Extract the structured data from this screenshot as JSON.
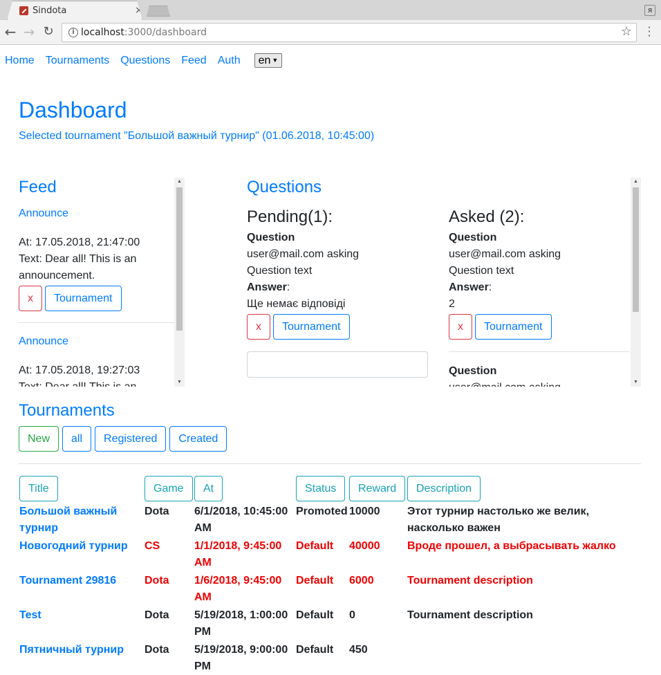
{
  "browser": {
    "tab_title": "Sindota",
    "tab_close": "×",
    "url_host": "localhost",
    "url_rest": ":3000/dashboard",
    "profile_glyph": "я"
  },
  "nav": {
    "home": "Home",
    "tournaments": "Tournaments",
    "questions": "Questions",
    "feed": "Feed",
    "auth": "Auth",
    "lang": "en"
  },
  "dashboard": {
    "title": "Dashboard",
    "selected": "Selected tournament \"Большой важный турнир\" (01.06.2018, 10:45:00)"
  },
  "feed": {
    "title": "Feed",
    "items": [
      {
        "type": "Announce",
        "at": "At: 17.05.2018, 21:47:00",
        "text": "Text: Dear all! This is an announcement.",
        "delete": "x",
        "tournament": "Tournament"
      },
      {
        "type": "Announce",
        "at": "At: 17.05.2018, 19:27:03",
        "text": "Text: Dear all! This is an"
      }
    ]
  },
  "questions": {
    "title": "Questions",
    "pending": {
      "heading": "Pending(1):",
      "question_label": "Question",
      "asker": "user@mail.com asking",
      "text": "Question text",
      "answer_label": "Answer",
      "answer": "Ще немає відповіді",
      "delete": "x",
      "tournament": "Tournament"
    },
    "asked": {
      "heading": "Asked (2):",
      "question_label": "Question",
      "asker": "user@mail.com asking",
      "text": "Question text",
      "answer_label": "Answer",
      "answer": "2",
      "delete": "x",
      "tournament": "Tournament",
      "next_question_label": "Question",
      "next_asker": "user@mail.com asking"
    }
  },
  "tournaments": {
    "title": "Tournaments",
    "filters": [
      "New",
      "all",
      "Registered",
      "Created"
    ],
    "columns": {
      "title": "Title",
      "game": "Game",
      "at": "At",
      "status": "Status",
      "reward": "Reward",
      "description": "Description"
    },
    "rows": [
      {
        "title": "Большой важный турнир",
        "game": "Dota",
        "at": "6/1/2018, 10:45:00 AM",
        "status": "Promoted",
        "reward": "10000",
        "description": "Этот турнир настолько же велик, насколько важен",
        "highlight": false
      },
      {
        "title": "Новогодний турнир",
        "game": "CS",
        "at": "1/1/2018, 9:45:00 AM",
        "status": "Default",
        "reward": "40000",
        "description": "Вроде прошел, а выбрасывать жалко",
        "highlight": true
      },
      {
        "title": "Tournament 29816",
        "game": "Dota",
        "at": "1/6/2018, 9:45:00 AM",
        "status": "Default",
        "reward": "6000",
        "description": "Tournament description",
        "highlight": true
      },
      {
        "title": "Test",
        "game": "Dota",
        "at": "5/19/2018, 1:00:00 PM",
        "status": "Default",
        "reward": "0",
        "description": "Tournament description",
        "highlight": false
      },
      {
        "title": "Пятничный турнир",
        "game": "Dota",
        "at": "5/19/2018, 9:00:00 PM",
        "status": "Default",
        "reward": "450",
        "description": "",
        "highlight": false
      }
    ]
  }
}
